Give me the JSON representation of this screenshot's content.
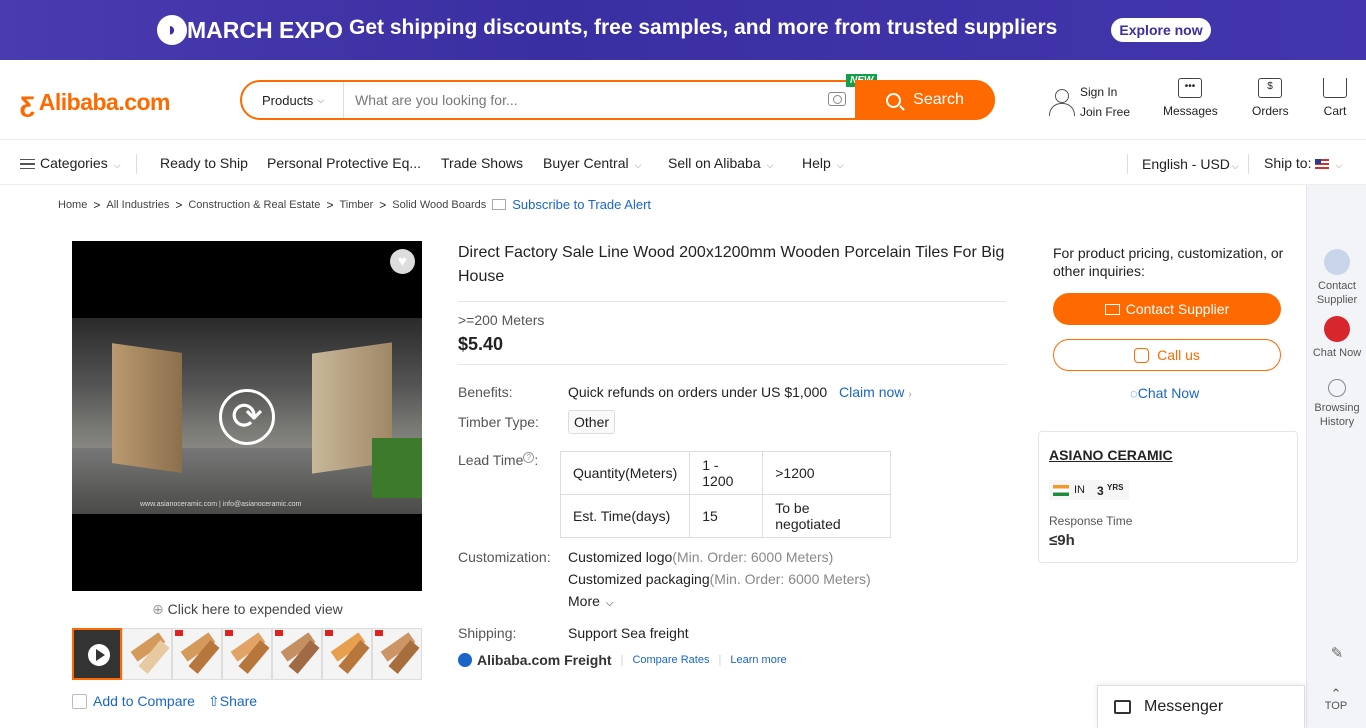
{
  "banner": {
    "brand": "MARCH EXPO",
    "headline": "Get shipping discounts, free samples, and more from trusted suppliers",
    "cta": "Explore now"
  },
  "header": {
    "logo": "Alibaba.com",
    "search": {
      "category": "Products",
      "placeholder": "What are you looking for...",
      "new_tag": "NEW",
      "button": "Search"
    },
    "sign_in": "Sign In",
    "join": "Join Free",
    "messages": "Messages",
    "orders": "Orders",
    "cart": "Cart"
  },
  "nav": {
    "categories": "Categories",
    "items": [
      "Ready to Ship",
      "Personal Protective Eq...",
      "Trade Shows",
      "Buyer Central",
      "Sell on Alibaba",
      "Help"
    ],
    "language": "English - USD",
    "ship_to": "Ship to:"
  },
  "breadcrumb": {
    "items": [
      "Home",
      "All Industries",
      "Construction & Real Estate",
      "Timber",
      "Solid Wood Boards"
    ],
    "subscribe": "Subscribe to Trade Alert"
  },
  "gallery": {
    "caption": "www.asianoceramic.com | info@asianoceramic.com",
    "expand": "Click here to expended view",
    "compare": "Add to Compare",
    "share": "Share"
  },
  "product": {
    "title": "Direct Factory Sale Line Wood 200x1200mm Wooden Porcelain Tiles For Big House",
    "moq": ">=200 Meters",
    "price": "$5.40",
    "benefits_label": "Benefits:",
    "benefits_value": "Quick refunds on orders under US $1,000",
    "claim": "Claim now",
    "timber_label": "Timber Type:",
    "timber_value": "Other",
    "lead_label": "Lead Time",
    "lead_table": {
      "row1": [
        "Quantity(Meters)",
        "1 - 1200",
        ">1200"
      ],
      "row2": [
        "Est. Time(days)",
        "15",
        "To be negotiated"
      ]
    },
    "custom_label": "Customization:",
    "custom_logo": "Customized logo",
    "custom_logo_min": "(Min. Order: 6000 Meters)",
    "custom_pack": "Customized packaging",
    "custom_pack_min": "(Min. Order: 6000 Meters)",
    "more": "More",
    "shipping_label": "Shipping:",
    "shipping_value": "Support Sea freight",
    "freight": "Alibaba.com Freight",
    "compare_rates": "Compare Rates",
    "learn_more": "Learn more"
  },
  "inquiry": {
    "text": "For product pricing, customization, or other inquiries:",
    "contact": "Contact Supplier",
    "call": "Call us",
    "chat": "Chat Now"
  },
  "supplier": {
    "name": "ASIANO CERAMIC",
    "country": "IN",
    "years": "3",
    "years_unit": "YRS",
    "response_label": "Response Time",
    "response_value": "≤9h"
  },
  "rail": {
    "contact": "Contact Supplier",
    "chat": "Chat Now",
    "history": "Browsing History",
    "top": "TOP"
  },
  "messenger": "Messenger",
  "colors": {
    "brand": "#ff6a00",
    "link": "#1a66c7",
    "banner": "#3a2fa2"
  }
}
